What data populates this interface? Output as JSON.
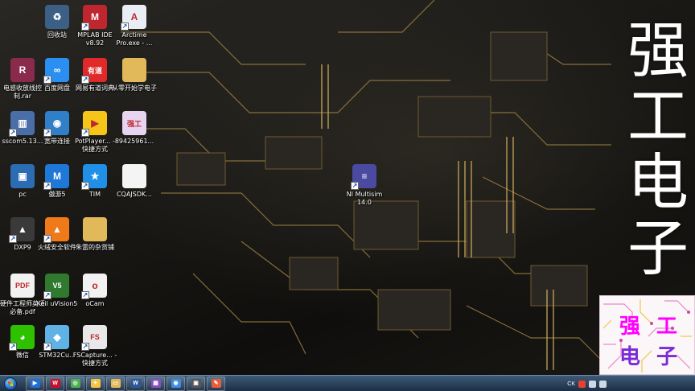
{
  "desktop": {
    "icons": [
      {
        "label": "回收站",
        "icon": "recycle-bin-icon",
        "color": "#3b5f85",
        "glyph": "♻",
        "shortcut": false
      },
      {
        "label": "MPLAB IDE v8.92",
        "icon": "mplab-icon",
        "color": "#c0262d",
        "glyph": "M",
        "shortcut": true
      },
      {
        "label": "Arctime Pro.exe - ...",
        "icon": "arctime-icon",
        "color": "#e9eef5",
        "glyph": "A",
        "shortcut": true
      },
      {
        "label": "电感收放线控制.rar",
        "icon": "winrar-icon",
        "color": "#8a2a4c",
        "glyph": "R",
        "shortcut": false
      },
      {
        "label": "百度网盘",
        "icon": "baidu-netdisk-icon",
        "color": "#2a8ff0",
        "glyph": "∞",
        "shortcut": true
      },
      {
        "label": "网易有道词典",
        "icon": "youdao-icon",
        "color": "#e02a2a",
        "glyph": "有道",
        "shortcut": true
      },
      {
        "label": "从零开始学电子",
        "icon": "folder-icon",
        "color": "#e2b95a",
        "glyph": "",
        "shortcut": false
      },
      {
        "label": "sscom5.13...",
        "icon": "sscom-icon",
        "color": "#4a6fa8",
        "glyph": "▥",
        "shortcut": true
      },
      {
        "label": "宽带连接",
        "icon": "broadband-icon",
        "color": "#2f7fc9",
        "glyph": "◉",
        "shortcut": true
      },
      {
        "label": "PotPlayer... - 快捷方式",
        "icon": "potplayer-icon",
        "color": "#f5c518",
        "glyph": "▶",
        "shortcut": true
      },
      {
        "label": "89425961...",
        "icon": "image-file-icon",
        "color": "#e6d4f0",
        "glyph": "强工",
        "shortcut": false
      },
      {
        "label": "pc",
        "icon": "computer-icon",
        "color": "#2b6cb3",
        "glyph": "▣",
        "shortcut": false
      },
      {
        "label": "傲游5",
        "icon": "maxthon-icon",
        "color": "#1e78d7",
        "glyph": "M",
        "shortcut": true
      },
      {
        "label": "TIM",
        "icon": "tim-icon",
        "color": "#1f8fe8",
        "glyph": "★",
        "shortcut": true
      },
      {
        "label": "CQAJSDK...",
        "icon": "file-icon",
        "color": "#f4f4f4",
        "glyph": "",
        "shortcut": false
      },
      {
        "label": "DXP9",
        "icon": "altium-dxp-icon",
        "color": "#3a3a3a",
        "glyph": "▲",
        "shortcut": true
      },
      {
        "label": "火绒安全软件",
        "icon": "huorong-icon",
        "color": "#f07a1a",
        "glyph": "▲",
        "shortcut": true
      },
      {
        "label": "朱雷的杂货铺",
        "icon": "folder-icon",
        "color": "#e2b95a",
        "glyph": "",
        "shortcut": false
      },
      {
        "label": "硬件工程师英语必备.pdf",
        "icon": "pdf-icon",
        "color": "#f2f2f2",
        "glyph": "PDF",
        "shortcut": false
      },
      {
        "label": "Keil uVision5",
        "icon": "keil-icon",
        "color": "#2f7a2f",
        "glyph": "V5",
        "shortcut": true
      },
      {
        "label": "oCam",
        "icon": "ocam-icon",
        "color": "#f2f2f2",
        "glyph": "o",
        "shortcut": true
      },
      {
        "label": "微信",
        "icon": "wechat-icon",
        "color": "#2dc100",
        "glyph": "◕",
        "shortcut": true
      },
      {
        "label": "STM32Cu...",
        "icon": "stm32cube-icon",
        "color": "#5fb2e6",
        "glyph": "◆",
        "shortcut": true
      },
      {
        "label": "FSCapture... - 快捷方式",
        "icon": "fscapture-icon",
        "color": "#e8e8e8",
        "glyph": "FS",
        "shortcut": true
      },
      {
        "label": "NI Multisim 14.0",
        "icon": "multisim-icon",
        "color": "#4a4aa0",
        "glyph": "≡",
        "shortcut": true
      }
    ]
  },
  "brand": {
    "chars": [
      "强",
      "工",
      "电",
      "子"
    ],
    "logo_chars": [
      "强",
      "工",
      "电",
      "子"
    ],
    "logo_colors": [
      "#ff00ff",
      "#ff00ff",
      "#7a2bd6",
      "#7a2bd6"
    ]
  },
  "taskbar": {
    "buttons": [
      {
        "icon": "media-player-icon",
        "color": "#1e6fd9",
        "glyph": "▶"
      },
      {
        "icon": "wps-icon",
        "color": "#c8102e",
        "glyph": "W"
      },
      {
        "icon": "chrome-icon",
        "color": "#4caf50",
        "glyph": "◎"
      },
      {
        "icon": "tool-icon",
        "color": "#f4c542",
        "glyph": "✦"
      },
      {
        "icon": "explorer-icon",
        "color": "#e2b95a",
        "glyph": "▭"
      },
      {
        "icon": "word-icon",
        "color": "#2b579a",
        "glyph": "W"
      },
      {
        "icon": "app-icon",
        "color": "#8a4fbf",
        "glyph": "▦"
      },
      {
        "icon": "browser-icon",
        "color": "#3a8ee6",
        "glyph": "◉"
      },
      {
        "icon": "terminal-icon",
        "color": "#555555",
        "glyph": "▣"
      },
      {
        "icon": "paint-icon",
        "color": "#e85d3a",
        "glyph": "✎"
      }
    ],
    "tray": {
      "ime": "CK",
      "icons": [
        {
          "icon": "sogou-icon",
          "color": "#e8412c"
        },
        {
          "icon": "network-icon",
          "color": "#cfd8e3"
        },
        {
          "icon": "volume-icon",
          "color": "#cfd8e3"
        }
      ]
    }
  }
}
